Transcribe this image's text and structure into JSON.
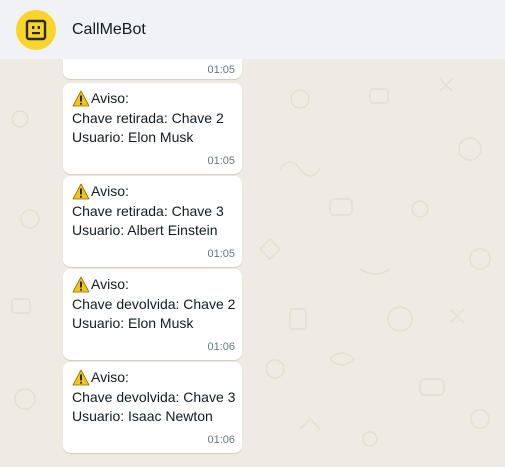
{
  "header": {
    "title": "CallMeBot",
    "avatar_icon": "robot-face-icon",
    "avatar_color": "#f9d52b"
  },
  "messages": [
    {
      "time": "01:05",
      "partial": true
    },
    {
      "warning_icon": "warning-icon",
      "heading": "Aviso:",
      "line1": "Chave retirada: Chave 2",
      "line2": "Usuario: Elon Musk",
      "time": "01:05"
    },
    {
      "warning_icon": "warning-icon",
      "heading": "Aviso:",
      "line1": "Chave retirada: Chave 3",
      "line2": "Usuario: Albert Einstein",
      "time": "01:05"
    },
    {
      "warning_icon": "warning-icon",
      "heading": "Aviso:",
      "line1": "Chave devolvida: Chave 2",
      "line2": "Usuario: Elon Musk",
      "time": "01:06"
    },
    {
      "warning_icon": "warning-icon",
      "heading": "Aviso:",
      "line1": "Chave devolvida: Chave 3",
      "line2": "Usuario: Isaac Newton",
      "time": "01:06"
    }
  ]
}
